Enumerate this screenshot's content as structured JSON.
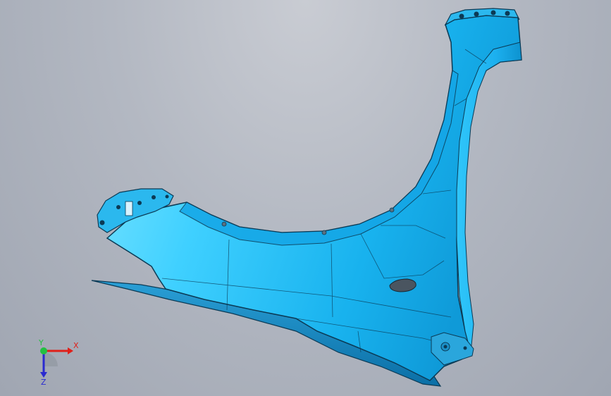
{
  "viewport": {
    "background_top": "#c9ccd3",
    "background_bottom": "#a0a6b2"
  },
  "model": {
    "part_color": "#1eb4f0",
    "highlight_color": "#7fe6ff",
    "edge_color": "#0b3a55",
    "hole_color": "#4a5560"
  },
  "triad": {
    "x_label": "X",
    "y_label": "Y",
    "z_label": "Z",
    "x_color": "#e0201a",
    "y_color": "#22c040",
    "z_color": "#2a2ad0"
  }
}
